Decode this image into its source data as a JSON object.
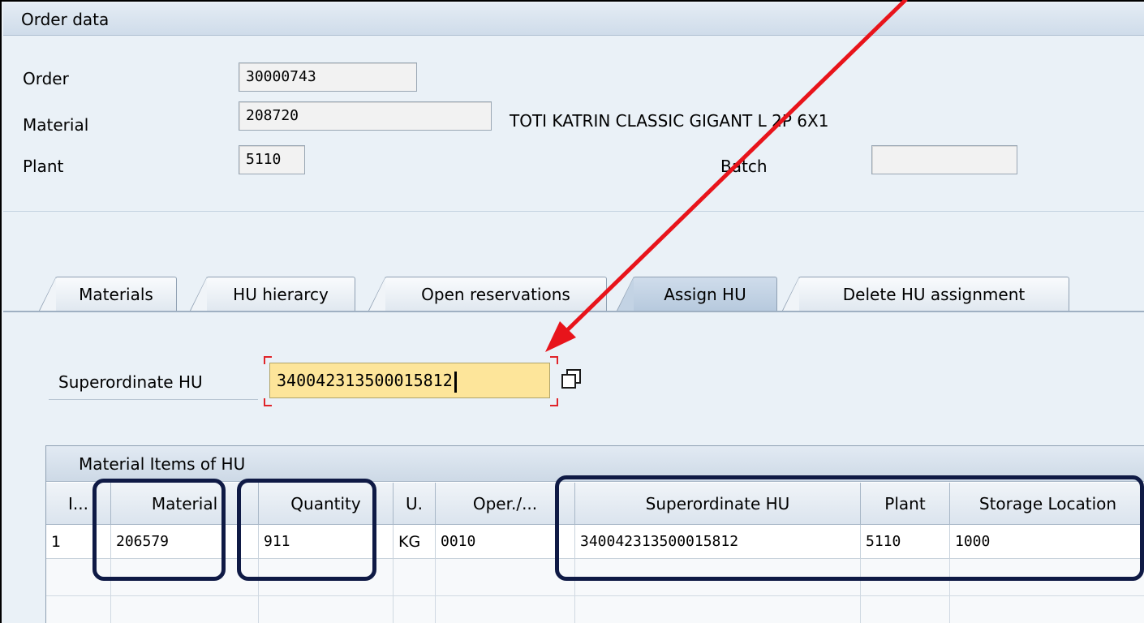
{
  "order_section": {
    "title": "Order data",
    "order_label": "Order",
    "order_value": "30000743",
    "material_label": "Material",
    "material_value": "208720",
    "material_desc": "TOTI KATRIN CLASSIC GIGANT L 2P 6X1",
    "plant_label": "Plant",
    "plant_value": "5110",
    "batch_label": "Batch",
    "batch_value": ""
  },
  "tabs": [
    {
      "label": "Materials",
      "active": false
    },
    {
      "label": "HU hierarcy",
      "active": false
    },
    {
      "label": "Open reservations",
      "active": false
    },
    {
      "label": "Assign HU",
      "active": true
    },
    {
      "label": "Delete HU assignment",
      "active": false
    }
  ],
  "superordinate": {
    "label": "Superordinate HU",
    "value": "340042313500015812"
  },
  "table": {
    "title": "Material Items of HU",
    "columns": [
      "I...",
      "Material",
      "Quantity",
      "U.",
      "Oper./...",
      "Superordinate HU",
      "Plant",
      "Storage Location"
    ],
    "rows": [
      [
        "1",
        "206579",
        "911",
        "KG",
        "0010",
        "340042313500015812",
        "5110",
        "1000"
      ]
    ]
  },
  "colors": {
    "annotation_arrow": "#e8141b",
    "highlight_box": "#0f1a45",
    "input_focus": "#fde59a"
  }
}
